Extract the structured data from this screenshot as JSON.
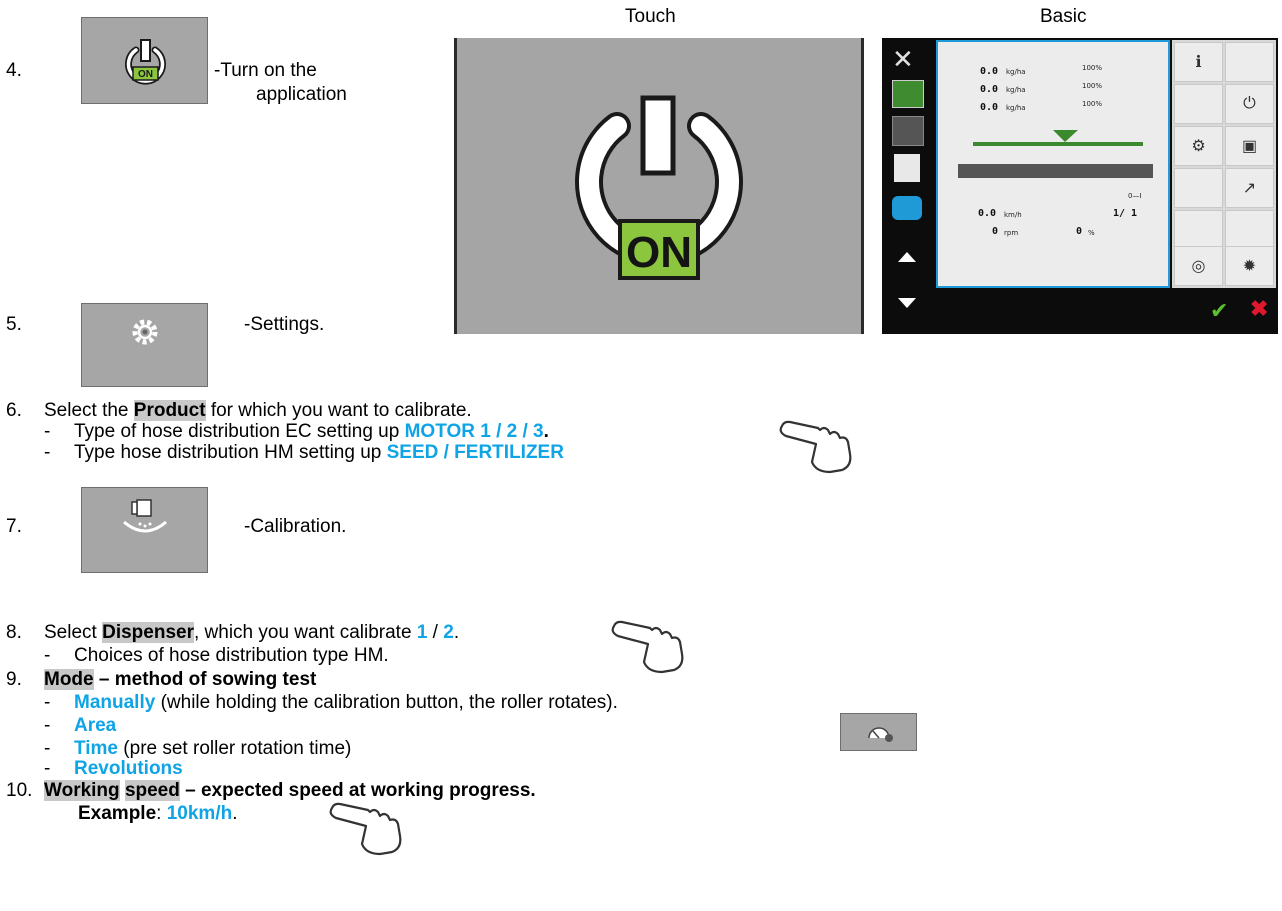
{
  "headers": {
    "touch": "Touch",
    "basic": "Basic"
  },
  "steps": {
    "s4": {
      "num": "4.",
      "text_line1": "-Turn on the",
      "text_line2": "application"
    },
    "s5": {
      "num": "5.",
      "text": "-Settings."
    },
    "s6": {
      "num": "6.",
      "pre": "Select the ",
      "product": "Product",
      "post": " for which you want to calibrate.",
      "sub1_dash": "-",
      "sub1_pre": "Type of hose distribution EC setting up ",
      "sub1_value": "MOTOR 1 / 2 / 3",
      "sub1_end": ".",
      "sub2_dash": "-",
      "sub2_pre": "Type hose distribution HM setting up ",
      "sub2_value": "SEED / FERTILIZER"
    },
    "s7": {
      "num": "7.",
      "text": "-Calibration."
    },
    "s8": {
      "num": "8.",
      "pre": "Select ",
      "dispenser": "Dispenser",
      "mid": ", which you want calibrate ",
      "v1": "1",
      "sep": " / ",
      "v2": "2",
      "end": ".",
      "sub_dash": "-",
      "sub": "Choices of hose distribution type HM."
    },
    "s9": {
      "num": "9.",
      "mode": "Mode",
      "rest": " – method of sowing test",
      "opt1_dash": "-",
      "opt1": "Manually",
      "opt1_rest": " (while holding the calibration button, the roller rotates).",
      "opt2_dash": "-",
      "opt2": "Area",
      "opt3_dash": "-",
      "opt3": "Time",
      "opt3_rest": " (pre set roller rotation time)",
      "opt4_dash": "-",
      "opt4": "Revolutions"
    },
    "s10": {
      "num": "10.",
      "w1": "Working",
      "w2": "speed",
      "rest": " – expected speed at working progress.",
      "ex_label": "Example",
      "ex_colon": ": ",
      "ex_value": "10km/h",
      "ex_end": "."
    }
  },
  "touch_panel": {
    "on_label": "ON"
  },
  "basic_terminal": {
    "rows": [
      {
        "value": "0.0",
        "unit": "kg/ha",
        "pct": "100%"
      },
      {
        "value": "0.0",
        "unit": "kg/ha",
        "pct": "100%"
      },
      {
        "value": "0.0",
        "unit": "kg/ha",
        "pct": "100%"
      }
    ],
    "speed": {
      "value": "0.0",
      "unit": "km/h"
    },
    "fraction": "1/ 1",
    "rpm": {
      "value": "0",
      "unit": "rpm"
    },
    "percent": {
      "value": "0",
      "unit": "%"
    },
    "section_label": "0—I"
  },
  "icons": {
    "power_on": "power-on-icon",
    "settings": "gear-icon",
    "calibration": "calibration-icon",
    "hand": "pointing-hand-icon",
    "speedometer": "speedometer-icon"
  },
  "colors": {
    "accent_blue": "#0fa4e6",
    "on_green": "#8cc63f",
    "highlight_gray": "#c8c8c8",
    "button_gray": "#a6a6a6"
  }
}
